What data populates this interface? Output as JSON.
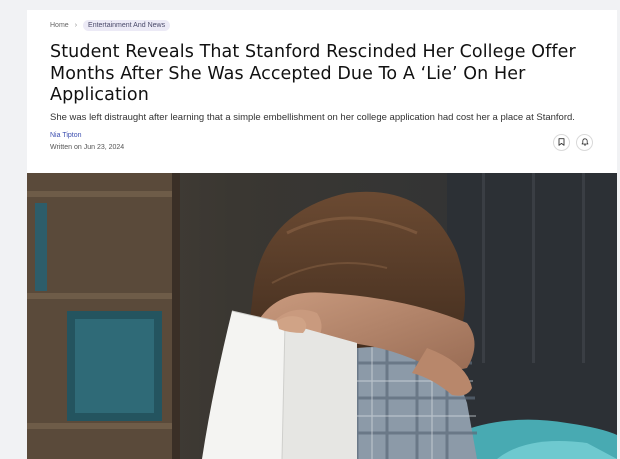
{
  "breadcrumb": {
    "home": "Home",
    "separator": "›",
    "category": "Entertainment And News"
  },
  "article": {
    "title": "Student Reveals That Stanford Rescinded Her College Offer Months After She Was Accepted Due To A ‘Lie’ On Her Application",
    "subtitle": "She was left distraught after learning that a simple embellishment on her college application had cost her a place at Stanford.",
    "author": "Nia Tipton",
    "date": "Written on Jun 23, 2024"
  },
  "actions": {
    "bookmark_icon": "bookmark-icon",
    "notify_icon": "bell-icon"
  },
  "colors": {
    "author_link": "#3d4fb0",
    "tag_bg": "#eceaf6"
  }
}
